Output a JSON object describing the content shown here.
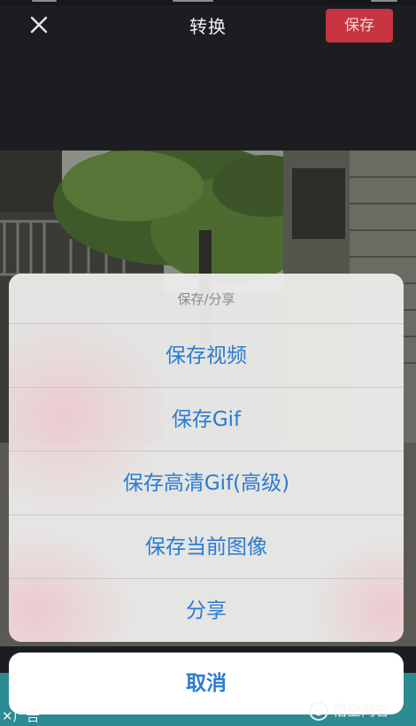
{
  "header": {
    "title": "转换",
    "save_label": "保存"
  },
  "action_sheet": {
    "title": "保存/分享",
    "items": [
      {
        "label": "保存视频"
      },
      {
        "label": "保存Gif"
      },
      {
        "label": "保存高清Gif(高级)"
      },
      {
        "label": "保存当前图像"
      },
      {
        "label": "分享"
      }
    ],
    "cancel_label": "取消"
  },
  "ad": {
    "label": "✕广告"
  },
  "watermark": {
    "text": "悟空问答"
  },
  "colors": {
    "accent_save": "#c8343f",
    "sheet_text": "#2b7bd2",
    "background": "#1c1d21"
  }
}
